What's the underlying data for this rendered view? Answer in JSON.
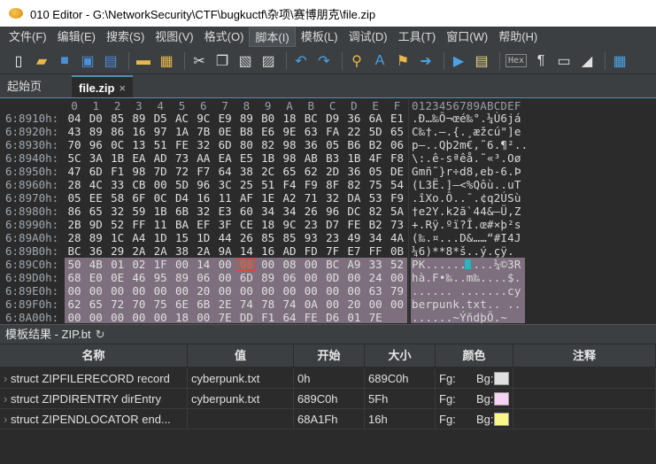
{
  "window": {
    "title": "010 Editor - G:\\NetworkSecurity\\CTF\\bugkuctf\\杂项\\赛博朋克\\file.zip"
  },
  "menu": [
    "文件(F)",
    "编辑(E)",
    "搜索(S)",
    "视图(V)",
    "格式(O)",
    "脚本(I)",
    "模板(L)",
    "调试(D)",
    "工具(T)",
    "窗口(W)",
    "帮助(H)"
  ],
  "menu_active": "脚本(I)",
  "toolbar": {
    "icons": [
      "new-file-icon",
      "open-folder-icon",
      "save-icon",
      "save-as-icon",
      "save-all-icon",
      "folder-icon",
      "folders-icon",
      "cut-icon",
      "copy-icon",
      "paste-icon",
      "paste-special-icon",
      "undo-icon",
      "redo-icon",
      "find-icon",
      "replace-icon",
      "find-in-files-icon",
      "goto-icon",
      "run-script-icon",
      "run-template-icon",
      "hex-mode-icon",
      "paragraph-icon",
      "insert-mode-icon",
      "highlight-icon",
      "calculator-icon"
    ],
    "hex_label": "Hex"
  },
  "tabs": {
    "start": "起始页",
    "file": "file.zip",
    "close_glyph": "×"
  },
  "hex": {
    "col_header": [
      "0",
      "1",
      "2",
      "3",
      "4",
      "5",
      "6",
      "7",
      "8",
      "9",
      "A",
      "B",
      "C",
      "D",
      "E",
      "F"
    ],
    "ascii_header": "0123456789ABCDEF",
    "rows": [
      {
        "addr": "6:8910h:",
        "bytes": [
          "04",
          "D0",
          "85",
          "89",
          "D5",
          "AC",
          "9C",
          "E9",
          "89",
          "B0",
          "18",
          "BC",
          "D9",
          "36",
          "6A",
          "E1"
        ],
        "ascii": ".Ð…‰Õ¬œé‰°.¼Ù6já"
      },
      {
        "addr": "6:8920h:",
        "bytes": [
          "43",
          "89",
          "86",
          "16",
          "97",
          "1A",
          "7B",
          "0E",
          "B8",
          "E6",
          "9E",
          "63",
          "FA",
          "22",
          "5D",
          "65"
        ],
        "ascii": "C‰†.—.{.¸æžcú\"]e"
      },
      {
        "addr": "6:8930h:",
        "bytes": [
          "70",
          "96",
          "0C",
          "13",
          "51",
          "FE",
          "32",
          "6D",
          "80",
          "82",
          "98",
          "36",
          "05",
          "B6",
          "B2",
          "06"
        ],
        "ascii": "p–..Qþ2m€‚˜6.¶².."
      },
      {
        "addr": "6:8940h:",
        "bytes": [
          "5C",
          "3A",
          "1B",
          "EA",
          "AD",
          "73",
          "AA",
          "EA",
          "E5",
          "1B",
          "98",
          "AB",
          "B3",
          "1B",
          "4F",
          "F8"
        ],
        "ascii": "\\:.ê-sªêå.˜«³.Oø"
      },
      {
        "addr": "6:8950h:",
        "bytes": [
          "47",
          "6D",
          "F1",
          "98",
          "7D",
          "72",
          "F7",
          "64",
          "38",
          "2C",
          "65",
          "62",
          "2D",
          "36",
          "05",
          "DE"
        ],
        "ascii": "Gmñ˜}r÷d8,eb-6.Þ"
      },
      {
        "addr": "6:8960h:",
        "bytes": [
          "28",
          "4C",
          "33",
          "CB",
          "00",
          "5D",
          "96",
          "3C",
          "25",
          "51",
          "F4",
          "F9",
          "8F",
          "82",
          "75",
          "54"
        ],
        "ascii": "(L3Ë.]–<%Qôù..uT"
      },
      {
        "addr": "6:8970h:",
        "bytes": [
          "05",
          "EE",
          "58",
          "6F",
          "0C",
          "D4",
          "16",
          "11",
          "AF",
          "1E",
          "A2",
          "71",
          "32",
          "DA",
          "53",
          "F9"
        ],
        "ascii": ".îXo.Ô..¯.¢q2ÚSù"
      },
      {
        "addr": "6:8980h:",
        "bytes": [
          "86",
          "65",
          "32",
          "59",
          "1B",
          "6B",
          "32",
          "E3",
          "60",
          "34",
          "34",
          "26",
          "96",
          "DC",
          "82",
          "5A"
        ],
        "ascii": "†e2Y.k2ã`44&–Ü‚Z"
      },
      {
        "addr": "6:8990h:",
        "bytes": [
          "2B",
          "9D",
          "52",
          "FF",
          "11",
          "BA",
          "EF",
          "3F",
          "CE",
          "18",
          "9C",
          "23",
          "D7",
          "FE",
          "B2",
          "73"
        ],
        "ascii": "+.Rÿ.ºï?Î.œ#×þ²s"
      },
      {
        "addr": "6:89A0h:",
        "bytes": [
          "28",
          "89",
          "1C",
          "A4",
          "1D",
          "15",
          "1D",
          "44",
          "26",
          "85",
          "85",
          "93",
          "23",
          "49",
          "34",
          "4A"
        ],
        "ascii": "(‰.¤...D&……“#I4J"
      },
      {
        "addr": "6:89B0h:",
        "bytes": [
          "BC",
          "36",
          "29",
          "2A",
          "2A",
          "38",
          "2A",
          "9A",
          "14",
          "16",
          "AD",
          "FD",
          "7F",
          "E7",
          "FF",
          "0B"
        ],
        "ascii": "¼6)**8*š..­ý.çÿ."
      },
      {
        "addr": "6:89C0h:",
        "bytes": [
          "50",
          "4B",
          "01",
          "02",
          "1F",
          "00",
          "14",
          "00",
          "08",
          "00",
          "08",
          "00",
          "BC",
          "A9",
          "33",
          "52"
        ],
        "ascii": "PK..........¼©3R"
      },
      {
        "addr": "6:89D0h:",
        "bytes": [
          "68",
          "E0",
          "0E",
          "46",
          "95",
          "89",
          "06",
          "00",
          "6D",
          "89",
          "06",
          "00",
          "0D",
          "00",
          "24",
          "00"
        ],
        "ascii": "hà.F•‰..m‰....$."
      },
      {
        "addr": "6:89E0h:",
        "bytes": [
          "00",
          "00",
          "00",
          "00",
          "00",
          "00",
          "20",
          "00",
          "00",
          "00",
          "00",
          "00",
          "00",
          "00",
          "63",
          "79"
        ],
        "ascii": "...... .......cy"
      },
      {
        "addr": "6:89F0h:",
        "bytes": [
          "62",
          "65",
          "72",
          "70",
          "75",
          "6E",
          "6B",
          "2E",
          "74",
          "78",
          "74",
          "0A",
          "00",
          "20",
          "00",
          "00"
        ],
        "ascii": "berpunk.txt.. .."
      },
      {
        "addr": "6:8A00h:",
        "bytes": [
          "00",
          "00",
          "00",
          "00",
          "00",
          "18",
          "00",
          "7E",
          "DD",
          "F1",
          "64",
          "FE",
          "D6",
          "01",
          "7E"
        ],
        "ascii": "......~ÝñdþÖ.~"
      }
    ]
  },
  "template_panel": {
    "title": "模板结果 - ZIP.bt",
    "refresh_glyph": "↻",
    "columns": [
      "名称",
      "值",
      "开始",
      "大小",
      "颜色",
      "注释"
    ],
    "rows": [
      {
        "name": "struct ZIPFILERECORD record",
        "value": "cyberpunk.txt",
        "start": "0h",
        "size": "689C0h",
        "fg": "Fg:",
        "bg": "Bg:",
        "bg_color": "#e0e0e0",
        "note": ""
      },
      {
        "name": "struct ZIPDIRENTRY dirEntry",
        "value": "cyberpunk.txt",
        "start": "689C0h",
        "size": "5Fh",
        "fg": "Fg:",
        "bg": "Bg:",
        "bg_color": "#f6d2f4",
        "note": ""
      },
      {
        "name": "struct ZIPENDLOCATOR end...",
        "value": "",
        "start": "68A1Fh",
        "size": "16h",
        "fg": "Fg:",
        "bg": "Bg:",
        "bg_color": "#fcf58a",
        "note": ""
      }
    ]
  }
}
